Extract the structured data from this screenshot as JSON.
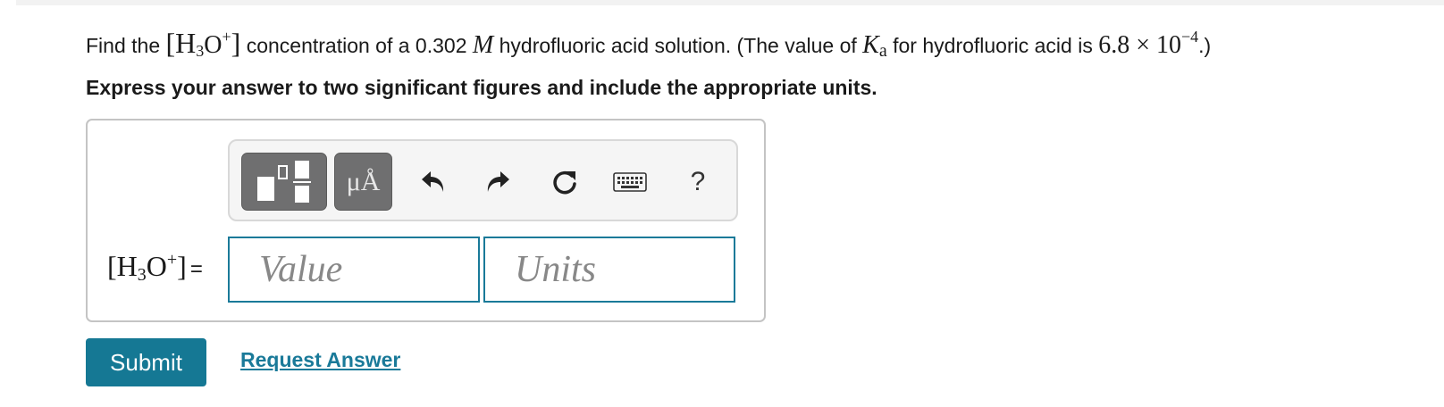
{
  "question": {
    "prefix": "Find the ",
    "species_open": "[H",
    "species_sub": "3",
    "species_o": "O",
    "species_sup": "+",
    "species_close": "]",
    "mid1": " concentration of a 0.302 ",
    "molar_symbol": "M",
    "mid2": "  hydrofluoric acid solution. (The value of ",
    "ka_symbol": "K",
    "ka_sub": "a",
    "mid3": "  for hydrofluoric acid is ",
    "ka_value": "6.8 × 10",
    "ka_exp": "−4",
    "suffix": ".)"
  },
  "instruction": "Express your answer to two significant figures and include the appropriate units.",
  "toolbar": {
    "units_label": "μÅ",
    "help_label": "?"
  },
  "equation": {
    "open": "[H",
    "sub": "3",
    "o": "O",
    "sup": "+",
    "close": "]",
    "equals": "="
  },
  "inputs": {
    "value_placeholder": "Value",
    "units_placeholder": "Units"
  },
  "actions": {
    "submit_label": "Submit",
    "request_answer_label": "Request Answer"
  },
  "colors": {
    "accent": "#157894",
    "toolbar_button": "#6f6f70",
    "field_border": "#1a7a99"
  },
  "icons": [
    "templates-icon",
    "units-icon",
    "undo-icon",
    "redo-icon",
    "reset-icon",
    "keyboard-icon",
    "help-icon"
  ]
}
